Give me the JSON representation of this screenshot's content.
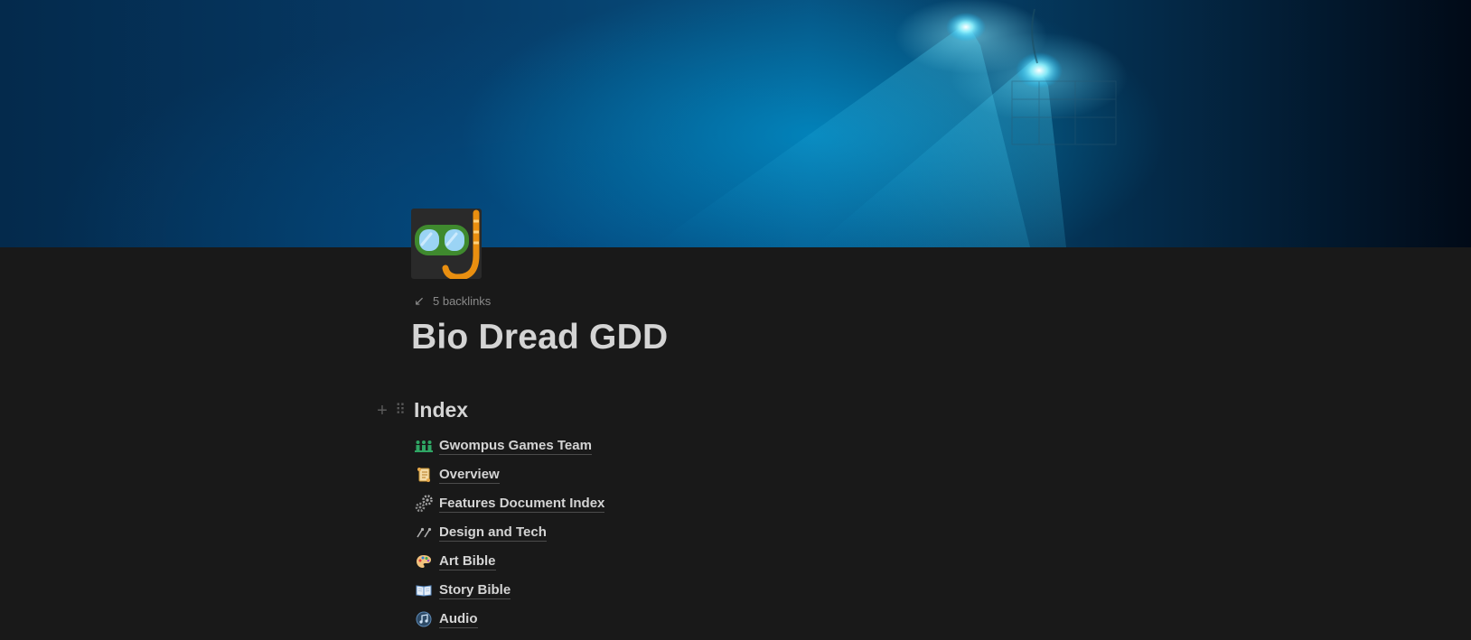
{
  "page": {
    "backlinks_label": "5 backlinks",
    "title": "Bio Dread GDD",
    "icon": "snorkel-mask-icon"
  },
  "section": {
    "heading": "Index"
  },
  "links": [
    {
      "label": "Gwompus Games Team",
      "icon": "team-people-icon"
    },
    {
      "label": "Overview",
      "icon": "scroll-icon"
    },
    {
      "label": "Features Document Index",
      "icon": "gears-icon"
    },
    {
      "label": "Design and Tech",
      "icon": "tools-icon"
    },
    {
      "label": "Art Bible",
      "icon": "palette-icon"
    },
    {
      "label": "Story Bible",
      "icon": "open-book-icon"
    },
    {
      "label": "Audio",
      "icon": "music-note-icon"
    }
  ],
  "colors": {
    "background": "#191919",
    "text": "#d4d4d4",
    "muted": "#8a8a8a",
    "cover_glow": "#00c8ff"
  }
}
